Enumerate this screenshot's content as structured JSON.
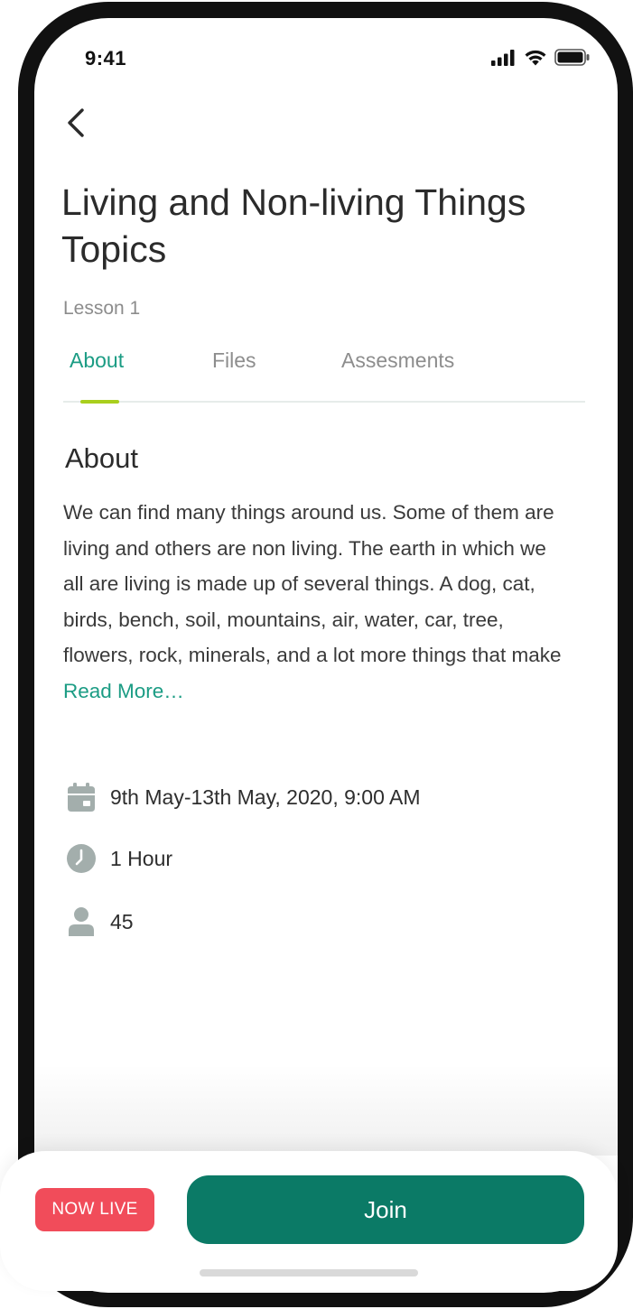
{
  "status_bar": {
    "time": "9:41",
    "icons": [
      "cellular-signal-icon",
      "wifi-icon",
      "battery-icon"
    ]
  },
  "header": {
    "back_icon": "chevron-left-icon",
    "title": "Living and Non-living Things Topics",
    "lesson": "Lesson 1"
  },
  "tabs": [
    {
      "label": "About",
      "active": true
    },
    {
      "label": "Files",
      "active": false
    },
    {
      "label": "Assesments",
      "active": false
    }
  ],
  "about": {
    "heading": "About",
    "body": "We can find many things around us. Some of them are living and others are non living. The earth in which we all are living is made up of several things. A dog, cat, birds, bench, soil, mountains, air, water, car, tree, flowers, rock, minerals, and a lot more things that make ",
    "read_more": "Read More…"
  },
  "details": {
    "date": {
      "icon": "calendar-icon",
      "text": "9th May-13th May, 2020, 9:00 AM"
    },
    "duration": {
      "icon": "clock-icon",
      "text": "1 Hour"
    },
    "attendees": {
      "icon": "person-icon",
      "text": "45"
    }
  },
  "footer": {
    "live_badge": "NOW LIVE",
    "join_label": "Join"
  },
  "colors": {
    "accent": "#1b9c84",
    "tab_indicator": "#a9cf1d",
    "join_button": "#0b7a66",
    "live_badge": "#f14c5a",
    "icon_gray": "#a3aeac"
  }
}
